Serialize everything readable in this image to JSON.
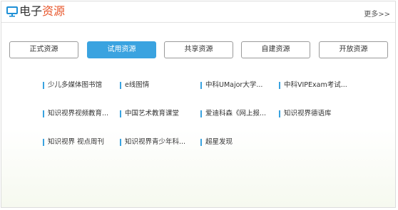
{
  "header": {
    "title_part1": "电子",
    "title_part2": "资源",
    "more_label": "更多>>",
    "icon": "monitor-icon",
    "accent_color": "#e8562b"
  },
  "tabs": [
    {
      "label": "正式资源",
      "active": false
    },
    {
      "label": "试用资源",
      "active": true
    },
    {
      "label": "共享资源",
      "active": false
    },
    {
      "label": "自建资源",
      "active": false
    },
    {
      "label": "开放资源",
      "active": false
    }
  ],
  "links": [
    "少儿多媒体图书馆",
    "e线图情",
    "中科UMajor大学...",
    "中科VIPExam考试...",
    "知识视界视频教育...",
    "中国艺术教育课堂",
    "爱迪科森《网上报...",
    "知识视界德语库",
    "知识视界 视点周刊",
    "知识视界青少年科...",
    "超星发现"
  ],
  "colors": {
    "tab_active": "#3aa3e0",
    "link_bar": "#3aa3e0"
  }
}
